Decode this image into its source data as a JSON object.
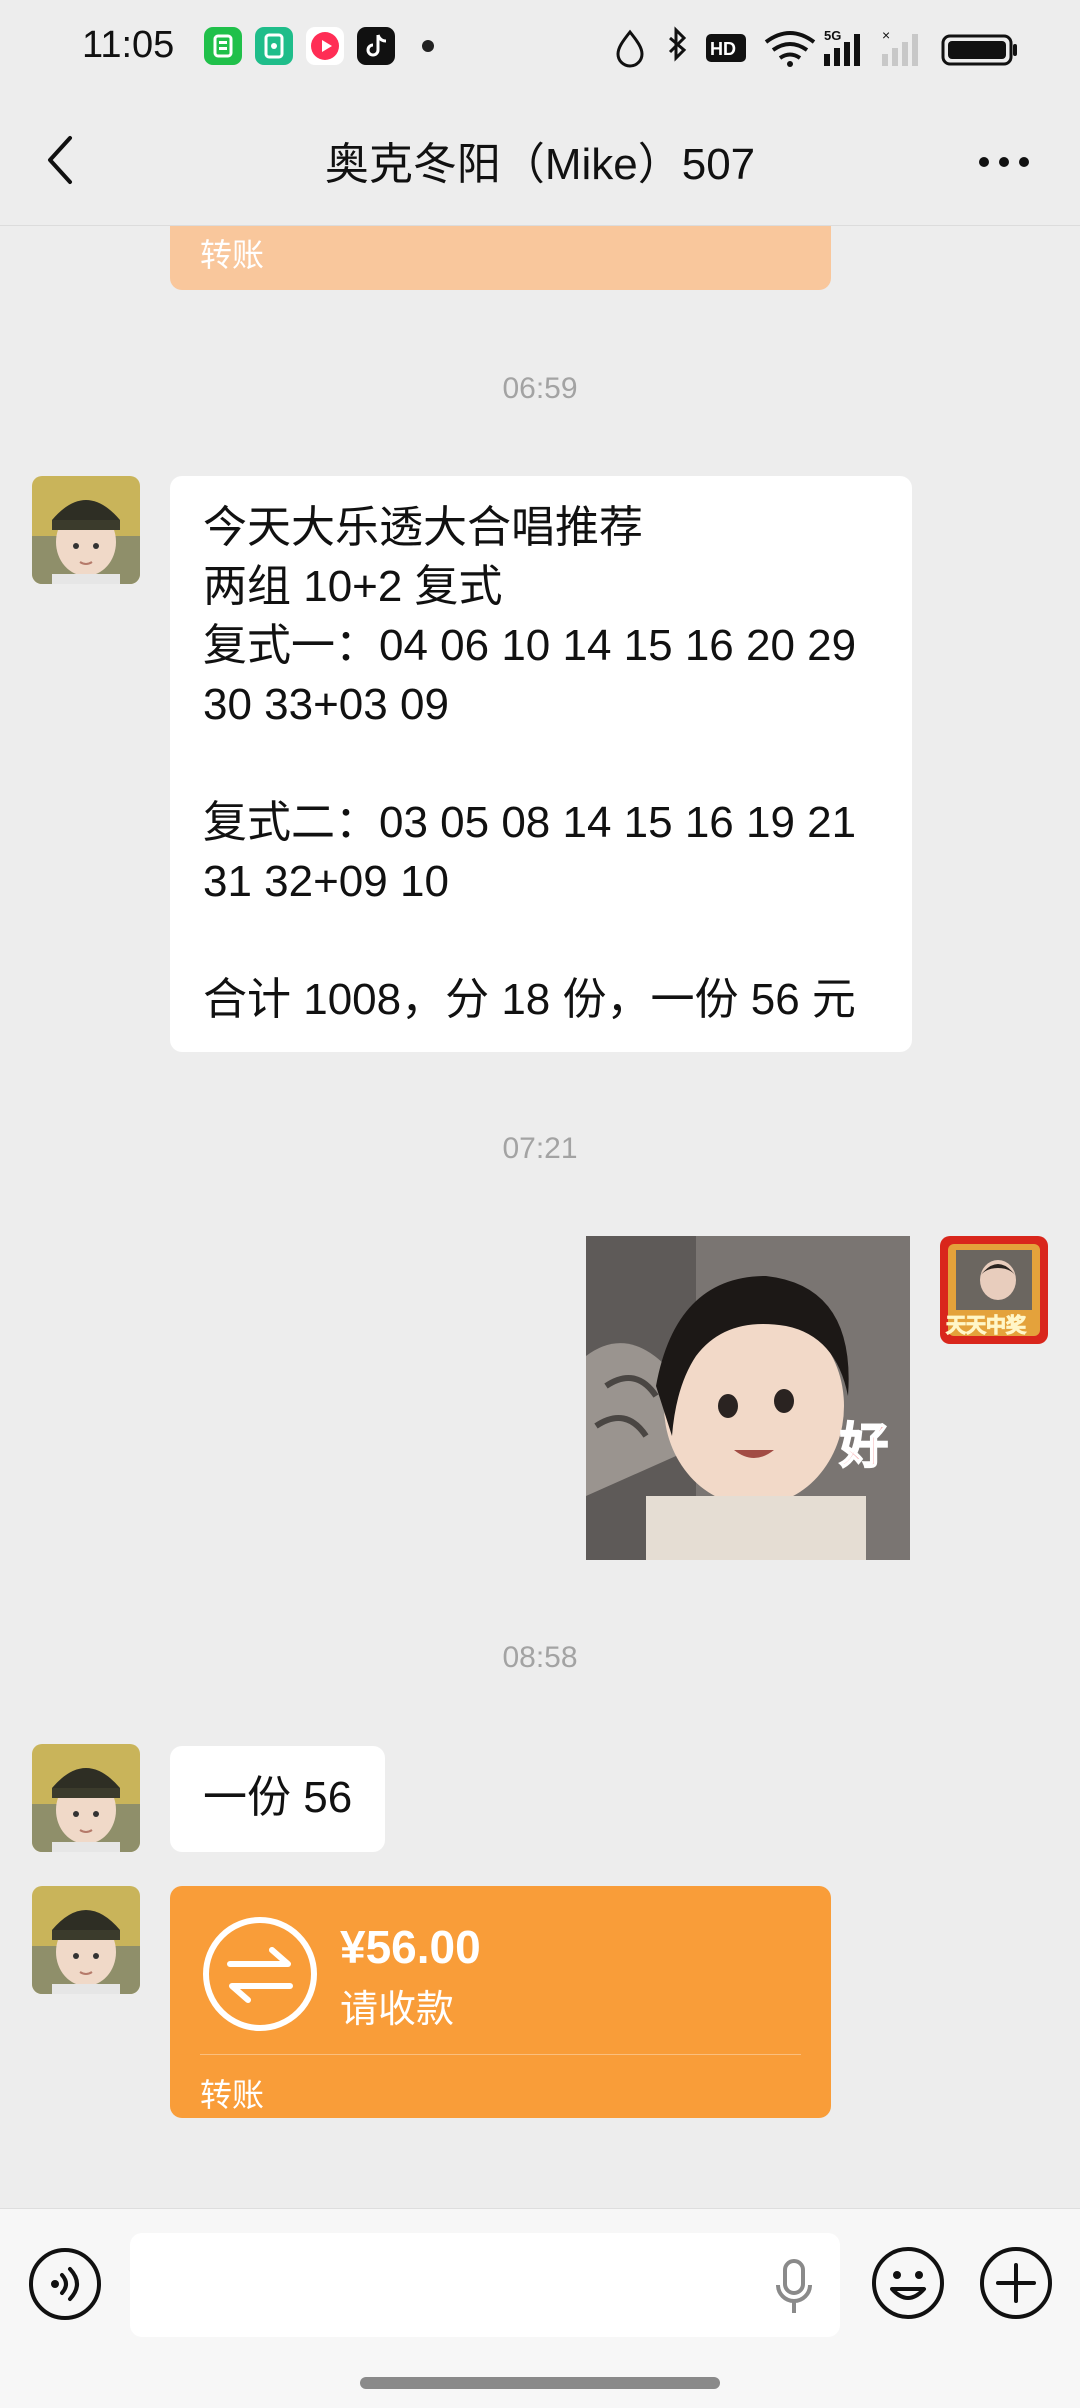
{
  "status_bar": {
    "time": "11:05",
    "colors": {
      "app1": "#20c04a",
      "app2": "#1fbd8a",
      "app3": "#ff2d55",
      "app4": "#111111"
    }
  },
  "header": {
    "title": "奥克冬阳（Mike）507"
  },
  "chat": {
    "partial_transfer_label": "转账",
    "messages": [
      {
        "timestamp": "06:59",
        "text": "今天大乐透大合唱推荐\n两组 10+2 复式\n复式一：04 06 10 14 15 16 20 29\n30 33+03 09\n\n复式二：03 05 08 14 15 16 19 21\n31 32+09 10\n\n合计 1008，分 18 份，一份 56 元"
      },
      {
        "timestamp": "07:21",
        "sticker_text": "好",
        "self_avatar_text": "天天中奖"
      },
      {
        "timestamp": "08:58",
        "text": "一份 56"
      },
      {
        "transfer_amount": "¥56.00",
        "transfer_status": "请收款",
        "transfer_label": "转账"
      }
    ]
  },
  "input": {
    "placeholder": ""
  },
  "theme": {
    "accent_transfer": "#f99d39",
    "background": "#ededed"
  }
}
